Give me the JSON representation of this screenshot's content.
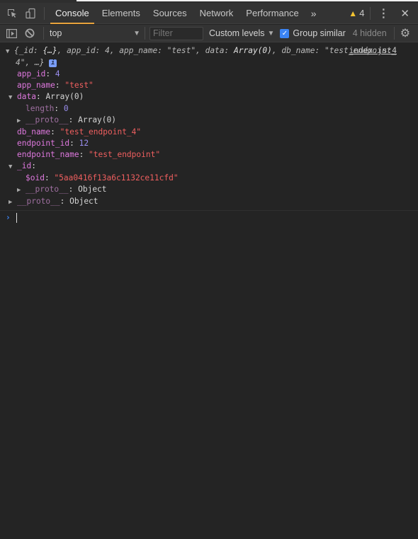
{
  "tabbar": {
    "tabs": [
      {
        "label": "Console",
        "active": true
      },
      {
        "label": "Elements",
        "active": false
      },
      {
        "label": "Sources",
        "active": false
      },
      {
        "label": "Network",
        "active": false
      },
      {
        "label": "Performance",
        "active": false
      }
    ],
    "more_tabs": "»",
    "warning_icon": "warning-triangle-icon",
    "warning_count": "4",
    "menu_icon": "⋮",
    "close_icon": "✕"
  },
  "toolbar": {
    "context": "top",
    "filter_placeholder": "Filter",
    "filter_value": "",
    "levels_label": "Custom levels",
    "group_similar_label": "Group similar",
    "group_similar_checked": true,
    "hidden_label": "4 hidden"
  },
  "console": {
    "source_link": "index.js:4",
    "summary": {
      "line1": {
        "open": "{",
        "id_key": "_id",
        "id_val": "{…}",
        "app_id_key": "app_id",
        "app_id_val": "4",
        "app_name_key": "app_name",
        "app_name_val": "\"test\"",
        "data_key": "data",
        "data_val": "Array(0)",
        "db_name_key": "db_name",
        "db_name_val_part1": "\"test_endpoint_"
      },
      "line2": {
        "db_name_val_part2": "4\"",
        "rest": ", …}"
      },
      "info_badge": "i"
    },
    "props": {
      "app_id": {
        "key": "app_id",
        "value": "4"
      },
      "app_name": {
        "key": "app_name",
        "value": "\"test\""
      },
      "data": {
        "key": "data",
        "value": "Array(0)",
        "expanded": true,
        "length": {
          "key": "length",
          "value": "0"
        },
        "proto": {
          "key": "__proto__",
          "value": "Array(0)"
        }
      },
      "db_name": {
        "key": "db_name",
        "value": "\"test_endpoint_4\""
      },
      "endpoint_id": {
        "key": "endpoint_id",
        "value": "12"
      },
      "endpoint_name": {
        "key": "endpoint_name",
        "value": "\"test_endpoint\""
      },
      "_id": {
        "key": "_id",
        "expanded": true,
        "oid": {
          "key": "$oid",
          "value": "\"5aa0416f13a6c1132ce11cfd\""
        },
        "proto": {
          "key": "__proto__",
          "value": "Object"
        }
      },
      "proto": {
        "key": "__proto__",
        "value": "Object"
      }
    },
    "prompt_symbol": "›"
  }
}
